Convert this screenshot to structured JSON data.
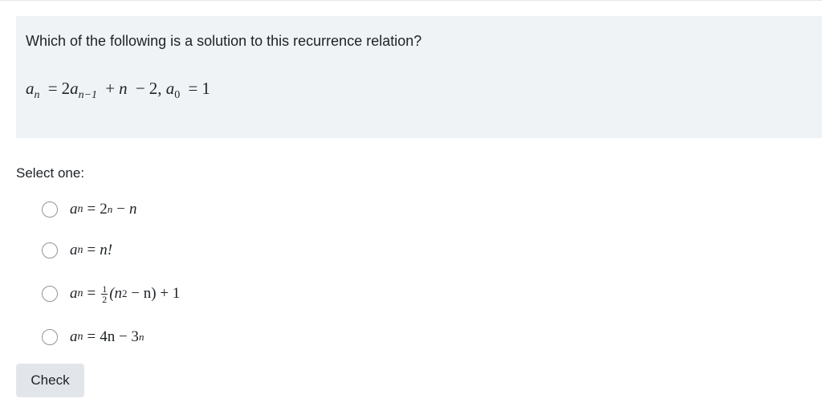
{
  "question": {
    "prompt": "Which of the following is a solution to this recurrence relation?",
    "formula": {
      "lhs_var": "a",
      "lhs_sub": "n",
      "eq": "=",
      "coef": "2",
      "term_var": "a",
      "term_sub": "n−1",
      "plus": "+",
      "n": "n",
      "minus": "−",
      "two": "2,",
      "init_var": "a",
      "init_sub": "0",
      "init_eq": "=",
      "init_val": "1"
    }
  },
  "select_label": "Select one:",
  "options": [
    {
      "var": "a",
      "sub": "n",
      "eq": "=",
      "base": "2",
      "exp": "n",
      "op": "−",
      "tail": "n"
    },
    {
      "var": "a",
      "sub": "n",
      "eq": "=",
      "expr": "n!"
    },
    {
      "var": "a",
      "sub": "n",
      "eq": "=",
      "frac_num": "1",
      "frac_den": "2",
      "open": "(n",
      "exp": "2",
      "rest": " − n) + 1"
    },
    {
      "var": "a",
      "sub": "n",
      "eq": "=",
      "lead": "4n − 3",
      "exp": "n"
    }
  ],
  "check_button": "Check"
}
